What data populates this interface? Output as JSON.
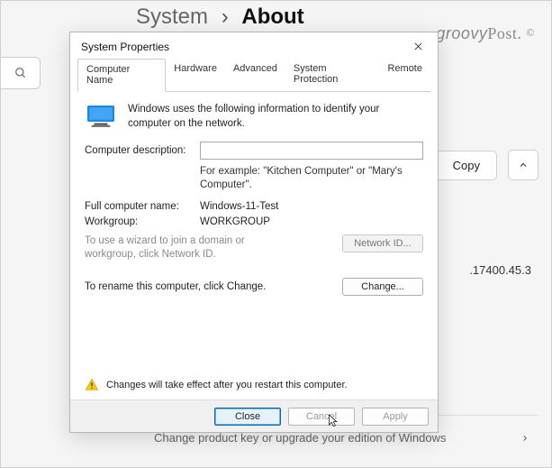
{
  "background": {
    "breadcrumb_parent": "System",
    "breadcrumb_separator": "›",
    "breadcrumb_current": "About",
    "watermark_brand": "groovy",
    "watermark_suffix": "Post.",
    "copy_button": "Copy",
    "ip_fragment": ".17400.45.3",
    "product_key_row": "Change product key or upgrade your edition of Windows"
  },
  "dialog": {
    "title": "System Properties",
    "tabs": {
      "computer_name": "Computer Name",
      "hardware": "Hardware",
      "advanced": "Advanced",
      "system_protection": "System Protection",
      "remote": "Remote"
    },
    "intro": "Windows uses the following information to identify your computer on the network.",
    "desc_label": "Computer description:",
    "desc_value": "",
    "desc_hint": "For example: \"Kitchen Computer\" or \"Mary's Computer\".",
    "full_name_label": "Full computer name:",
    "full_name_value": "Windows-11-Test",
    "workgroup_label": "Workgroup:",
    "workgroup_value": "WORKGROUP",
    "wizard_text": "To use a wizard to join a domain or workgroup, click Network ID.",
    "network_id_btn": "Network ID...",
    "rename_text": "To rename this computer, click Change.",
    "change_btn": "Change...",
    "notice": "Changes will take effect after you restart this computer.",
    "close_btn": "Close",
    "cancel_btn": "Cancel",
    "apply_btn": "Apply"
  }
}
